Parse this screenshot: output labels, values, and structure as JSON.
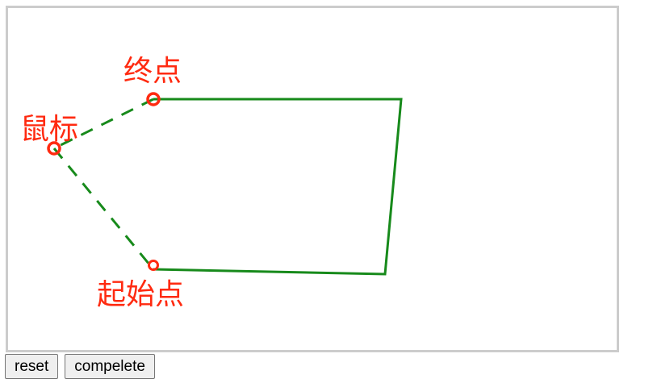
{
  "canvas": {
    "labels": {
      "end_point": "终点",
      "mouse": "鼠标",
      "start_point": "起始点"
    },
    "colors": {
      "line": "#178a1b",
      "marker": "#ff2a10",
      "label": "#ff2a10",
      "border": "#cccccc"
    }
  },
  "buttons": {
    "reset_label": "reset",
    "complete_label": "compelete"
  }
}
